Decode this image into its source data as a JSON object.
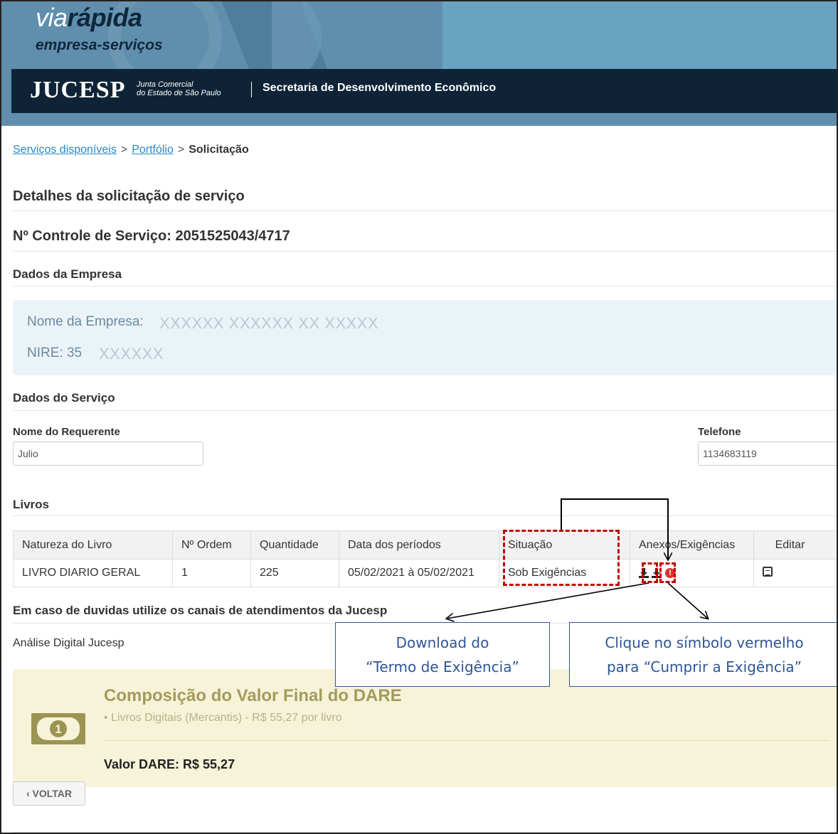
{
  "banner": {
    "logo_via": "via",
    "logo_rapida": "rápida",
    "logo_sub": "empresa-serviços",
    "jucesp": "JUCESP",
    "jucesp_line1": "Junta Comercial",
    "jucesp_line2": "do Estado de São Paulo",
    "secretaria": "Secretaria de Desenvolvimento Econômico"
  },
  "breadcrumb": {
    "item1": "Serviços disponíveis",
    "item2": "Portfólio",
    "current": "Solicitação",
    "separator": ">"
  },
  "headings": {
    "detalhes": "Detalhes da solicitação de serviço",
    "controle": "Nº Controle de Serviço: 2051525043/4717",
    "empresa": "Dados da Empresa",
    "servico": "Dados do Serviço",
    "livros": "Livros",
    "duvidas": "Em caso de duvidas utilize os canais de atendimentos da Jucesp"
  },
  "empresa": {
    "nome_label": "Nome da Empresa:",
    "nome_value": "XXXXXX XXXXXX XX XXXXX",
    "nire_label": "NIRE: 35",
    "nire_value": "XXXXXX"
  },
  "servico": {
    "requerente_label": "Nome do Requerente",
    "requerente_value": "Julio",
    "telefone_label": "Telefone",
    "telefone_value": "1134683119"
  },
  "livros_table": {
    "headers": [
      "Natureza do Livro",
      "Nº Ordem",
      "Quantidade",
      "Data dos períodos",
      "Situação",
      "Anexos/Exigências",
      "Editar"
    ],
    "rows": [
      {
        "natureza": "LIVRO DIARIO GERAL",
        "ordem": "1",
        "quantidade": "225",
        "periodo": "05/02/2021 à 05/02/2021",
        "situacao": "Sob Exigências"
      }
    ],
    "icons": [
      "download-icon",
      "download-icon",
      "alert-icon",
      "edit-icon"
    ]
  },
  "callouts": {
    "download_line1": "Download do",
    "download_line2": "“Termo de Exigência”",
    "cumprir_line1": "Clique no símbolo vermelho",
    "cumprir_line2": "para “Cumprir a Exigência”"
  },
  "analise": "Análise Digital Jucesp",
  "dare": {
    "title": "Composição do Valor Final do DARE",
    "item": "Livros Digitais (Mercantis) - R$ 55,27 por livro",
    "valor": "Valor DARE: R$ 55,27",
    "icon": "money-icon"
  },
  "voltar": "VOLTAR",
  "colors": {
    "banner": "#5f8fad",
    "topbar": "#0e2436",
    "link": "#2a87c8",
    "annotation_red": "#c00000",
    "callout_blue": "#2f5597",
    "dare_bg": "#f6f3d9"
  }
}
